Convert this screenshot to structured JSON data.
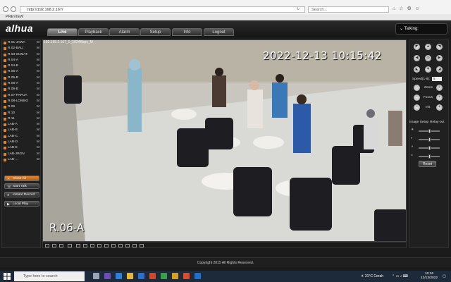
{
  "browser": {
    "url": "http://192.168.2.167/",
    "search_placeholder": "Search...",
    "tab_title": "PREVIEW"
  },
  "app": {
    "logo": "alhua",
    "nav_tabs": [
      {
        "label": "Live",
        "active": true
      },
      {
        "label": "Playback"
      },
      {
        "label": "Alarm"
      },
      {
        "label": "Setup"
      },
      {
        "label": "Info"
      },
      {
        "label": "Logout"
      }
    ],
    "talking_label": "Talking:"
  },
  "channels": [
    {
      "name": "R.01-JAWA",
      "flag": "M"
    },
    {
      "name": "R.02-BALI",
      "flag": "M"
    },
    {
      "name": "R.03-SUMAT.",
      "flag": "M"
    },
    {
      "name": "R.04-A",
      "flag": "M"
    },
    {
      "name": "R.04-B",
      "flag": "M"
    },
    {
      "name": "R.05-A",
      "flag": "M"
    },
    {
      "name": "R.05-B",
      "flag": "M"
    },
    {
      "name": "R.06-A",
      "flag": "M"
    },
    {
      "name": "R.06-B",
      "flag": "M"
    },
    {
      "name": "R.07-PAPUA",
      "flag": "M"
    },
    {
      "name": "R.08-LOMBO",
      "flag": "M"
    },
    {
      "name": "R.09",
      "flag": "M"
    },
    {
      "name": "R.10",
      "flag": "M"
    },
    {
      "name": "R.11",
      "flag": "M"
    },
    {
      "name": "LAB-A",
      "flag": "M"
    },
    {
      "name": "LAB-B",
      "flag": "M"
    },
    {
      "name": "LAB-C",
      "flag": "M"
    },
    {
      "name": "LAB-D",
      "flag": "M"
    },
    {
      "name": "LAB-E",
      "flag": "M"
    },
    {
      "name": "LAB-JRGN",
      "flag": "M"
    },
    {
      "name": "LAB-...",
      "flag": "M"
    }
  ],
  "actions": {
    "close_all": "Close All",
    "start_talk": "Start Talk",
    "instant_record": "Instant Record",
    "local_play": "Local Play"
  },
  "video": {
    "stream_info": "192.168.2.167_0_1024Kbps_M",
    "timestamp": "2022-12-13 10:15:42",
    "channel_name": "R.06-A"
  },
  "ptz": {
    "speed_label": "Speed(1-8):",
    "speed_value": "5",
    "zoom_label": "Zoom",
    "focus_label": "Focus",
    "iris_label": "Iris",
    "image_setup_label": "Image Setup",
    "relay_out_label": "Relay-out",
    "reset_label": "Reset",
    "sliders": [
      0.5,
      0.5,
      0.5,
      0.5
    ]
  },
  "footer": {
    "copyright": "Copyright 2015 All Rights Reserved."
  },
  "taskbar": {
    "search_placeholder": "Type here to search",
    "weather": "31°C Cerah",
    "time": "10:16",
    "date": "12/13/2022"
  }
}
